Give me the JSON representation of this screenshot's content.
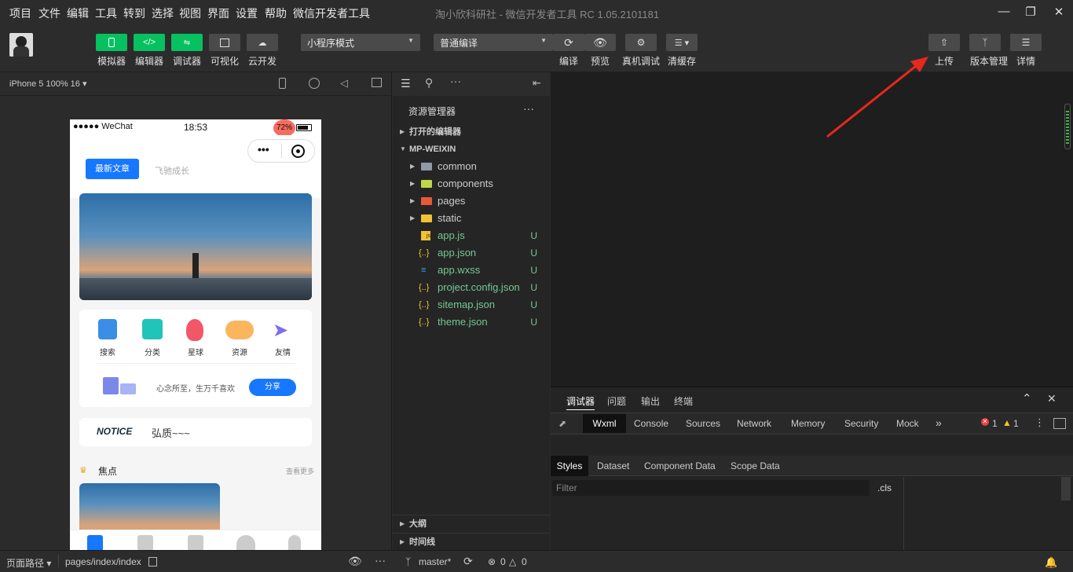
{
  "menu": [
    "项目",
    "文件",
    "编辑",
    "工具",
    "转到",
    "选择",
    "视图",
    "界面",
    "设置",
    "帮助",
    "微信开发者工具"
  ],
  "window_title": "淘小欣科研社 - 微信开发者工具 RC 1.05.2101181",
  "toolbar": {
    "simulator": "模拟器",
    "editor": "编辑器",
    "debugger": "调试器",
    "visual": "可视化",
    "cloud": "云开发",
    "mode_select": "小程序模式",
    "compile_select": "普通编译",
    "compile": "编译",
    "preview": "预览",
    "real_debug": "真机调试",
    "clear_cache": "清缓存",
    "upload": "上传",
    "version": "版本管理",
    "details": "详情"
  },
  "simulator": {
    "device": "iPhone 5 100% 16",
    "status_carrier": "●●●●● WeChat",
    "status_time": "18:53",
    "status_battery": "72%",
    "tab_latest": "最新文章",
    "tab_other": "飞驰成长",
    "icons": [
      "搜索",
      "分类",
      "星球",
      "资源",
      "友情"
    ],
    "share_text": "心念所至，生万千喜欢",
    "share_button": "分享",
    "notice_brand": "NOTICE",
    "notice_text": "弘质~~~",
    "focus_title": "焦点",
    "focus_more": "查看更多"
  },
  "explorer": {
    "title": "资源管理器",
    "open_editors": "打开的编辑器",
    "project": "MP-WEIXIN",
    "folders": [
      "common",
      "components",
      "pages",
      "static"
    ],
    "files": [
      {
        "name": "app.js",
        "icon": "js",
        "status": "U"
      },
      {
        "name": "app.json",
        "icon": "{..}",
        "status": "U"
      },
      {
        "name": "app.wxss",
        "icon": "css",
        "status": "U"
      },
      {
        "name": "project.config.json",
        "icon": "{..}",
        "status": "U"
      },
      {
        "name": "sitemap.json",
        "icon": "{..}",
        "status": "U"
      },
      {
        "name": "theme.json",
        "icon": "{..}",
        "status": "U"
      }
    ],
    "outline": "大纲",
    "timeline": "时间线"
  },
  "devtools": {
    "top_tabs": [
      "调试器",
      "问题",
      "输出",
      "终端"
    ],
    "panel_tabs": [
      "Wxml",
      "Console",
      "Sources",
      "Network",
      "Memory",
      "Security",
      "Mock"
    ],
    "errors": "1",
    "warnings": "1",
    "style_tabs": [
      "Styles",
      "Dataset",
      "Component Data",
      "Scope Data"
    ],
    "filter_placeholder": "Filter",
    "cls": ".cls"
  },
  "status": {
    "page_path_label": "页面路径",
    "page_path": "pages/index/index",
    "branch": "master*",
    "errors": "0",
    "warnings": "0"
  },
  "colors": {
    "green": "#07c160",
    "accent_blue": "#1677ff",
    "arrow_red": "#e8281c"
  }
}
